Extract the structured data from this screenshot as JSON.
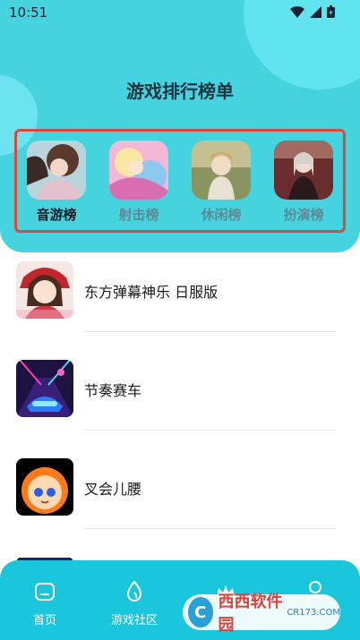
{
  "status": {
    "time": "10:51"
  },
  "header": {
    "title": "游戏排行榜单"
  },
  "categories": [
    {
      "label": "音游榜",
      "active": true
    },
    {
      "label": "射击榜",
      "active": false
    },
    {
      "label": "休闲榜",
      "active": false
    },
    {
      "label": "扮演榜",
      "active": false
    }
  ],
  "games": [
    {
      "name": "东方弹幕神乐 日服版"
    },
    {
      "name": "节奏赛车"
    },
    {
      "name": "叉会儿腰"
    }
  ],
  "nav": {
    "home": "首页",
    "community": "游戏社区"
  },
  "watermark": {
    "brand": "西西软件园",
    "site": "CR173.COM",
    "logo": "C"
  },
  "colors": {
    "header_bg": "#45d3e0",
    "highlight_border": "#d94a3c",
    "nav_bg": "#19c6db"
  }
}
